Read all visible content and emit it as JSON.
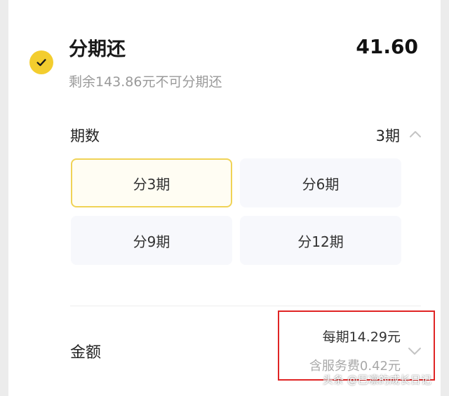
{
  "payment": {
    "title": "分期还",
    "amount": "41.60",
    "note": "剩余143.86元不可分期还"
  },
  "periods": {
    "label": "期数",
    "selected_value": "3期",
    "options": [
      {
        "label": "分3期",
        "selected": true
      },
      {
        "label": "分6期",
        "selected": false
      },
      {
        "label": "分9期",
        "selected": false
      },
      {
        "label": "分12期",
        "selected": false
      }
    ]
  },
  "amount_section": {
    "label": "金额",
    "per_period": "每期14.29元",
    "service_fee": "含服务费0.42元"
  },
  "watermark": "头条 @巴凛的成长日记",
  "colors": {
    "accent_yellow": "#f3cd2e",
    "selected_border": "#f0d356",
    "highlight_red": "#e02424"
  }
}
